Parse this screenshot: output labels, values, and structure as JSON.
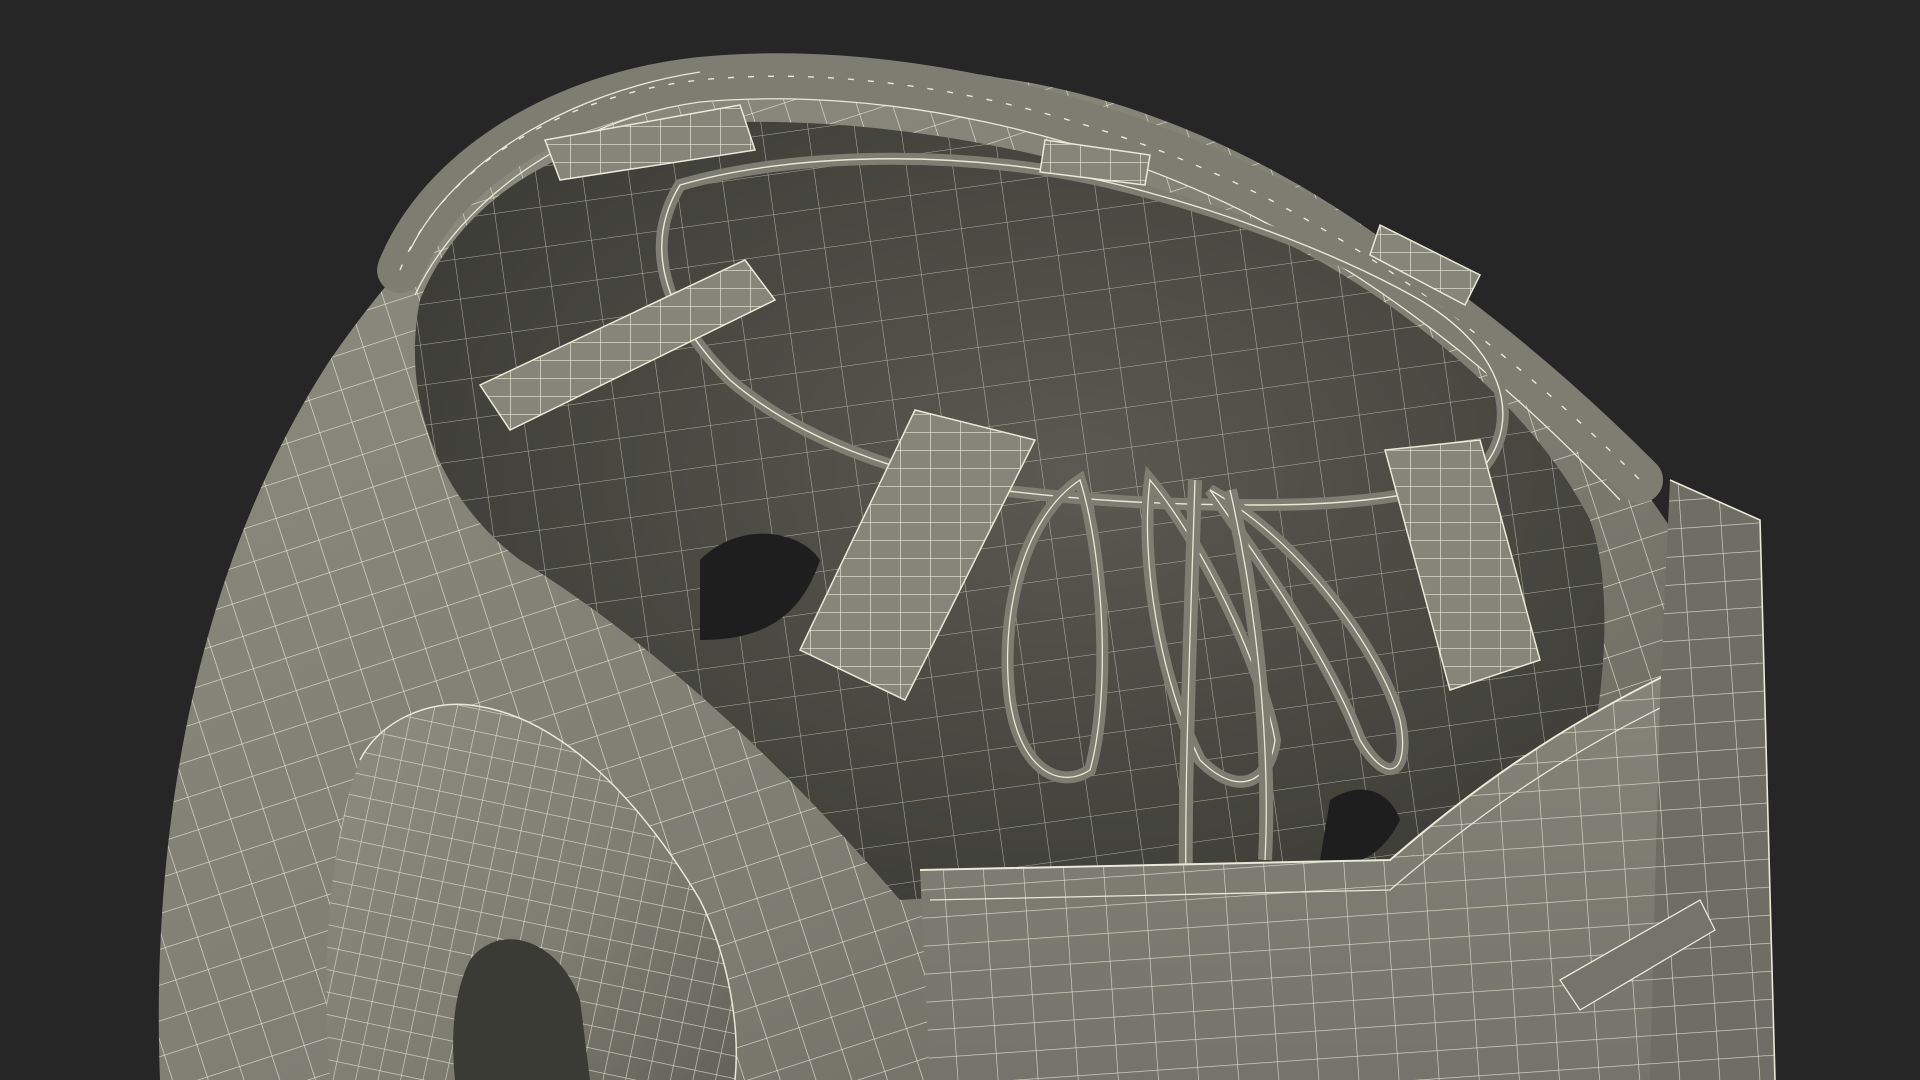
{
  "scene": {
    "subject": "wireframe-3d-render",
    "colors": {
      "background": "#262626",
      "shell": "#7d7d72",
      "shell_light": "#8c8c80",
      "shell_shadow": "#5e5e55",
      "interior": "#4a4a43",
      "interior_dark": "#3b3b35",
      "wire": "#e9e9d8",
      "wire_soft": "#cfcfc0"
    }
  }
}
